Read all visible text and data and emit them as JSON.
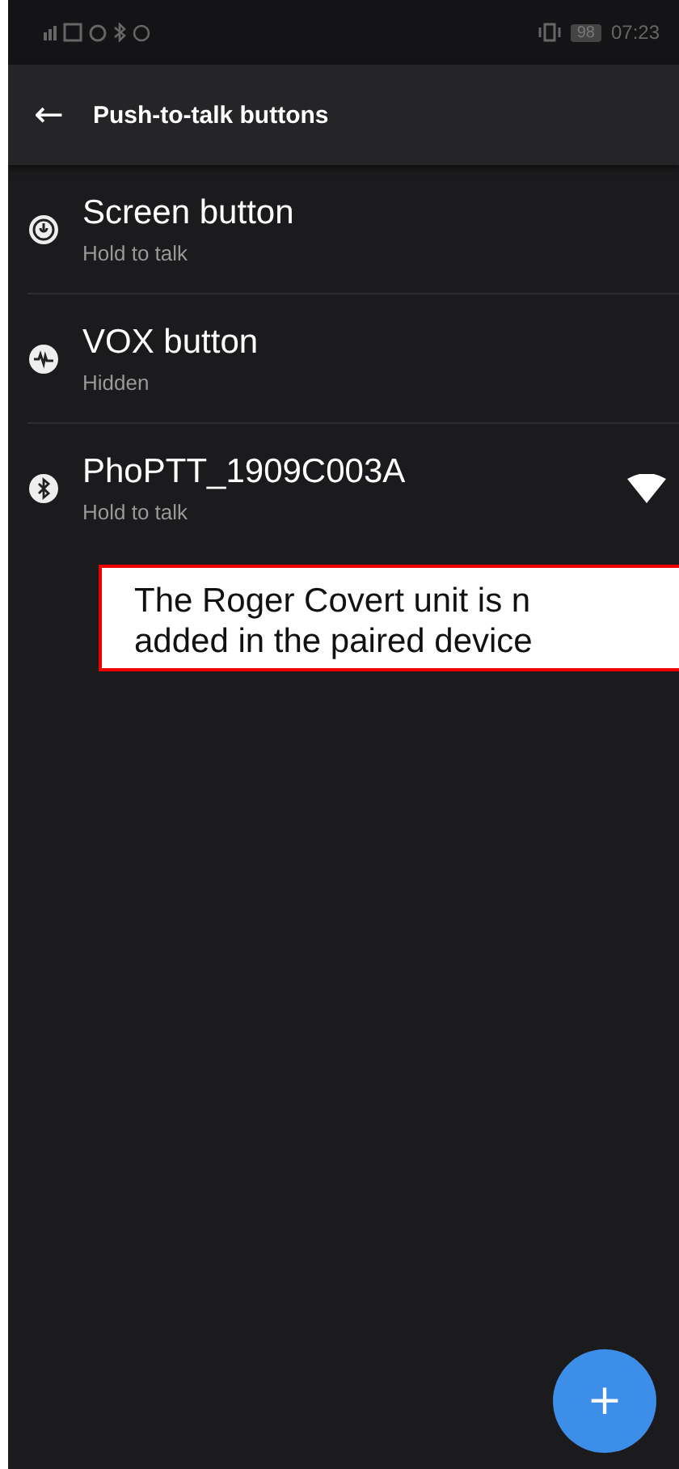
{
  "status_bar": {
    "battery": "98",
    "time": "07:23"
  },
  "app_bar": {
    "back": "←",
    "title": "Push-to-talk buttons"
  },
  "buttons": [
    {
      "kind": "mic",
      "name": "Screen button",
      "mode": "Hold to talk",
      "connected": false
    },
    {
      "kind": "wave",
      "name": "VOX button",
      "mode": "Hidden",
      "connected": false
    },
    {
      "kind": "bluetooth",
      "name": "PhoPTT_1909C003A",
      "mode": "Hold to talk",
      "connected": true
    }
  ],
  "callout": {
    "lines": [
      "The Roger Covert unit is n",
      "added in the paired device"
    ]
  },
  "fab": {
    "label": "+"
  }
}
